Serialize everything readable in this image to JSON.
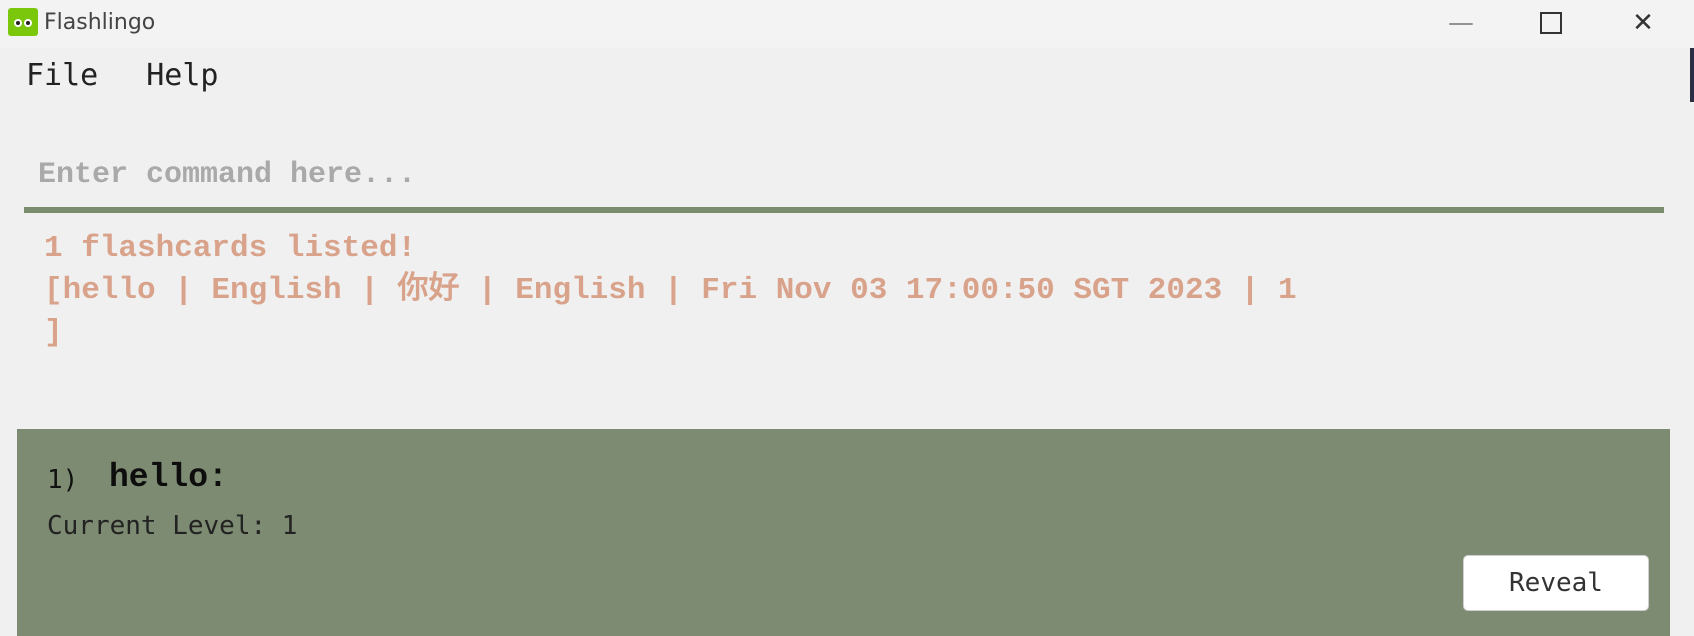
{
  "window": {
    "title": "Flashlingo",
    "minimize_symbol": "—",
    "close_symbol": "✕",
    "icon": "owl-logo-icon",
    "accent": "#7ac70c"
  },
  "menubar": {
    "items": [
      {
        "label": "File"
      },
      {
        "label": "Help"
      }
    ]
  },
  "command": {
    "placeholder": "Enter command here...",
    "value": "",
    "underline_color": "#7c8d6e"
  },
  "result": {
    "lines": [
      "1 flashcards listed!",
      "[hello | English | 你好 | English | Fri Nov 03 17:00:50 SGT 2023 | 1",
      "]"
    ],
    "text_color": "#d9a38b"
  },
  "flashcards": [
    {
      "index": "1)",
      "word": "hello:",
      "level_text": "Current Level: 1",
      "reveal_label": "Reveal"
    }
  ],
  "colors": {
    "panel_background": "#7c8b71",
    "window_background": "#f0f0f0"
  }
}
